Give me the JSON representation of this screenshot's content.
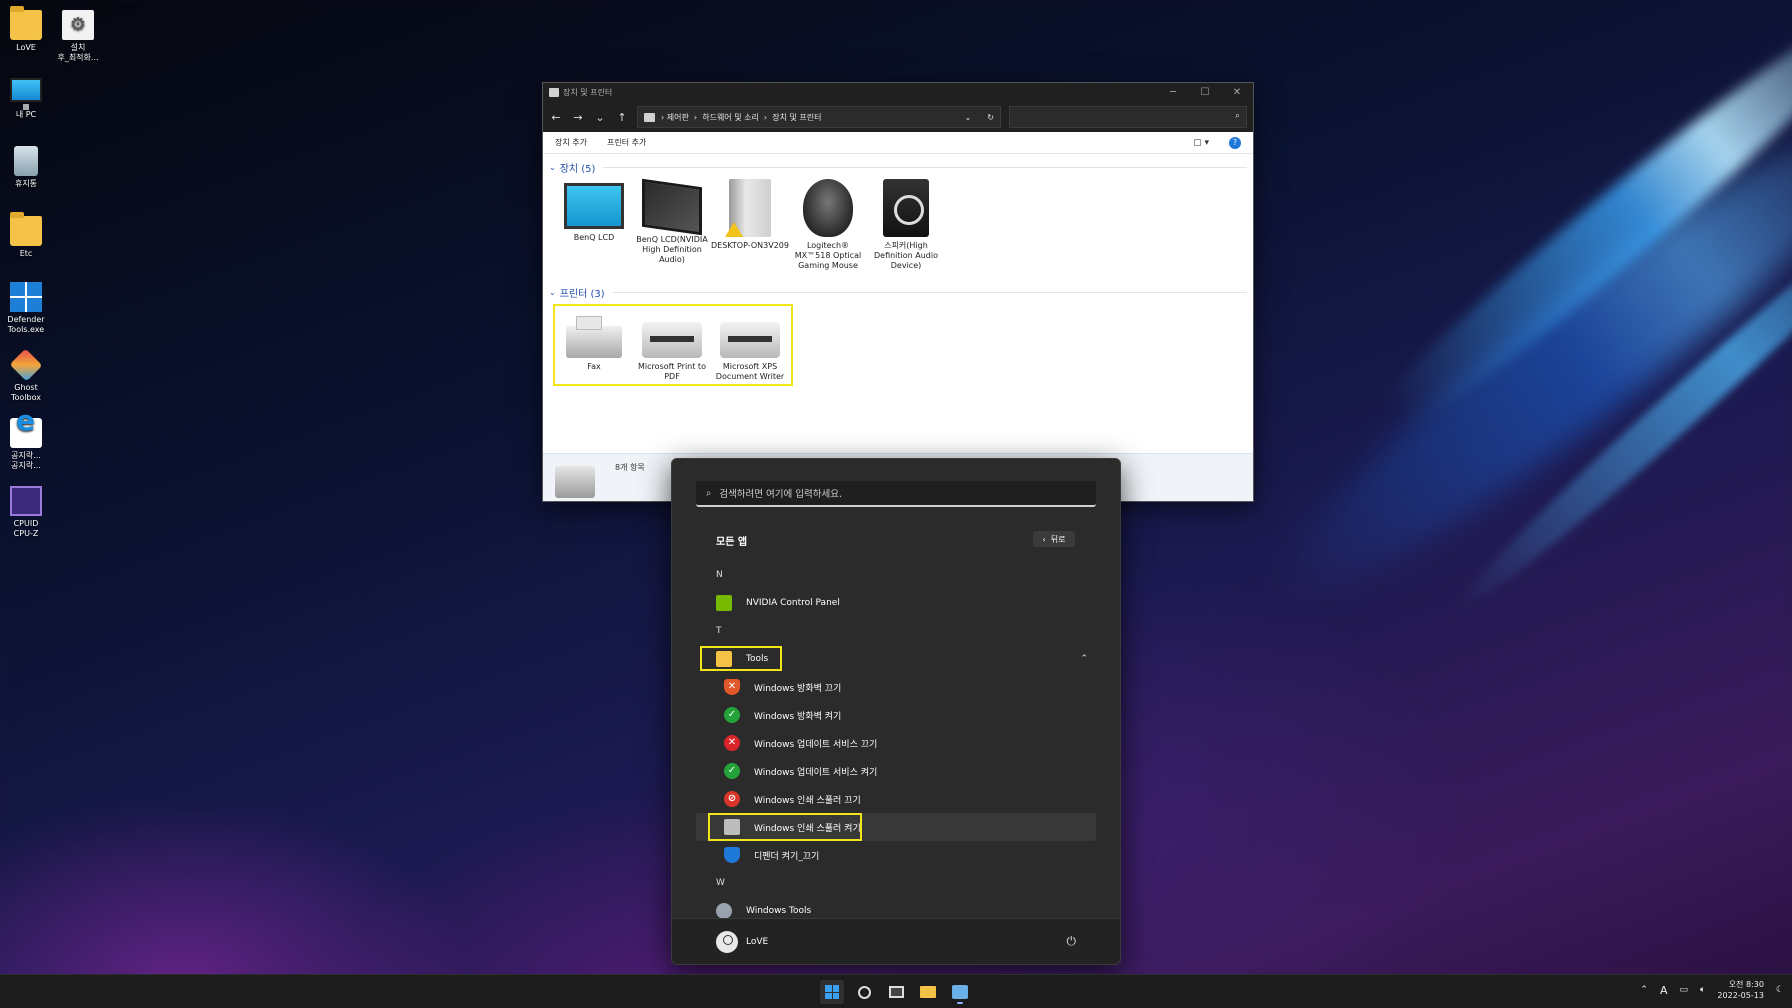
{
  "desktop": {
    "icons": [
      {
        "label": "LoVE",
        "icon": "folder-icon"
      },
      {
        "label": "설치\n후_최적화...",
        "icon": "settings-shortcut-icon"
      },
      {
        "label": "내 PC",
        "icon": "this-pc-icon"
      },
      {
        "label": "휴지통",
        "icon": "recycle-bin-icon"
      },
      {
        "label": "Etc",
        "icon": "folder-icon"
      },
      {
        "label": "Defender\nTools.exe",
        "icon": "defender-tools-icon"
      },
      {
        "label": "Ghost\nToolbox",
        "icon": "ghost-toolbox-icon"
      },
      {
        "label": "공지락...\n공지락...",
        "icon": "internet-explorer-icon"
      },
      {
        "label": "CPUID\nCPU-Z",
        "icon": "cpuz-icon"
      }
    ]
  },
  "explorer": {
    "title": "장치 및 프린터",
    "address_parts": [
      "제어판",
      "하드웨어 및 소리",
      "장치 및 프린터"
    ],
    "commands": {
      "add_device": "장치 추가",
      "add_printer": "프린터 추가"
    },
    "devices_header": "장치 (5)",
    "devices": [
      {
        "label": "BenQ LCD",
        "icon": "monitor-icon"
      },
      {
        "label": "BenQ LCD(NVIDIA High Definition Audio)",
        "icon": "monitor-audio-icon"
      },
      {
        "label": "DESKTOP-ON3V209",
        "icon": "computer-tower-icon"
      },
      {
        "label": "Logitech® MX™518 Optical Gaming Mouse",
        "icon": "mouse-icon"
      },
      {
        "label": "스피커(High Definition Audio Device)",
        "icon": "speaker-icon"
      }
    ],
    "printers_header": "프린터 (3)",
    "printers": [
      {
        "label": "Fax",
        "icon": "fax-icon"
      },
      {
        "label": "Microsoft Print to PDF",
        "icon": "printer-icon"
      },
      {
        "label": "Microsoft XPS Document Writer",
        "icon": "printer-icon"
      }
    ],
    "status": "8개 항목"
  },
  "start_menu": {
    "search_placeholder": "검색하려면 여기에 입력하세요.",
    "all_apps": "모든 앱",
    "back": "뒤로",
    "sections": {
      "N": "N",
      "nvidia": "NVIDIA Control Panel",
      "T": "T",
      "tools": "Tools",
      "tools_items": [
        "Windows 방화벽 끄기",
        "Windows 방화벽 켜기",
        "Windows 업데이트 서비스 끄기",
        "Windows 업데이트 서비스 켜기",
        "Windows 인쇄 스풀러 끄기",
        "Windows 인쇄 스풀러 켜기",
        "디펜더 켜기_끄기"
      ],
      "W": "W",
      "windows_tools": "Windows Tools"
    },
    "user": "LoVE"
  },
  "taskbar": {
    "ime": "A",
    "time": "오전 8:30",
    "date": "2022-05-13"
  },
  "colors": {
    "highlight": "#f2e51a",
    "accent": "#1e78d7",
    "group_header": "#1e4fa8"
  }
}
